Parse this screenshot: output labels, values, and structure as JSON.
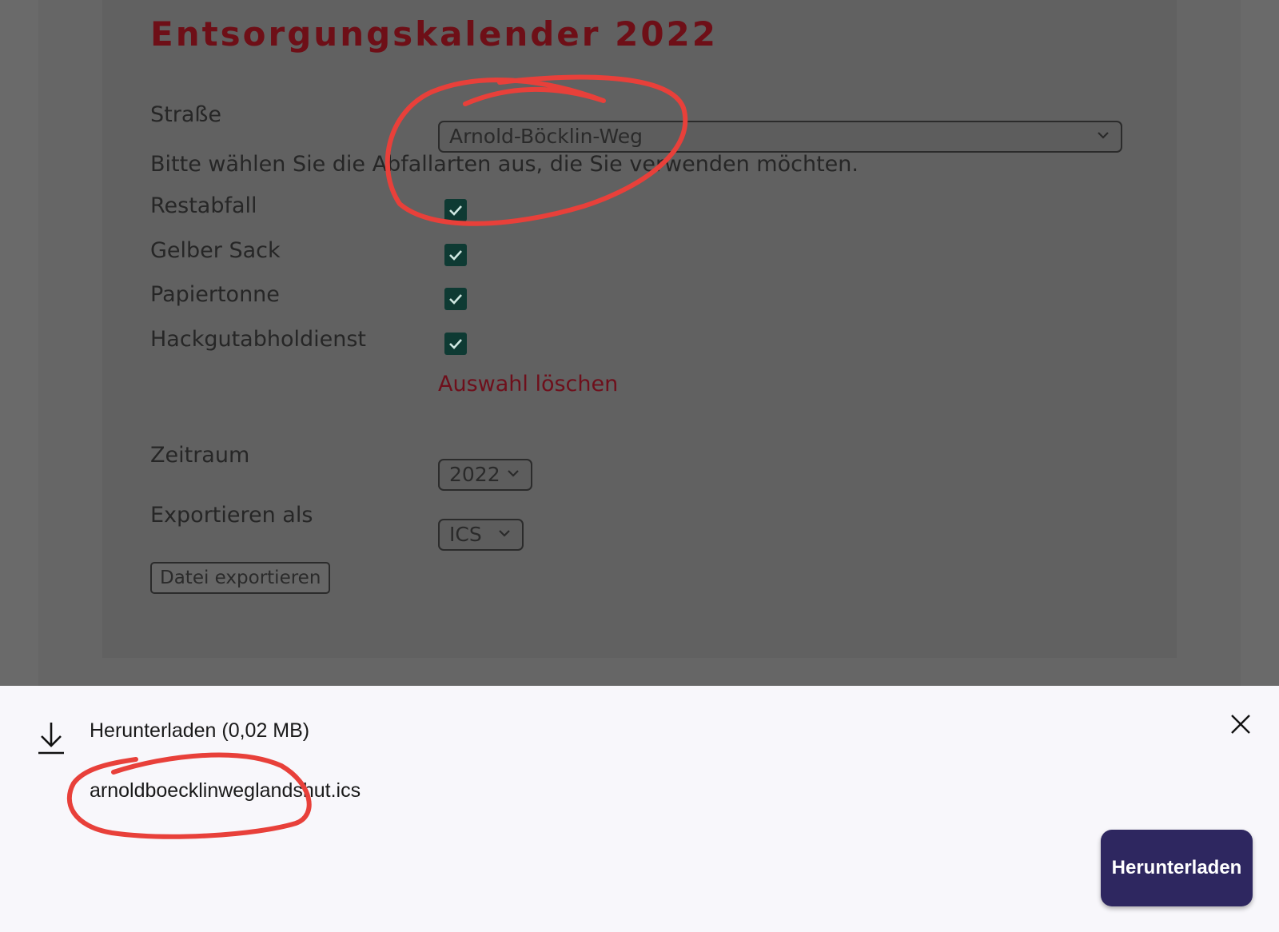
{
  "page": {
    "title": "Entsorgungskalender 2022"
  },
  "form": {
    "street_label": "Straße",
    "street_value": "Arnold-Böcklin-Weg",
    "instruction": "Bitte wählen Sie die Abfallarten aus, die Sie verwenden möchten.",
    "waste_types": [
      {
        "label": "Restabfall",
        "checked": true
      },
      {
        "label": "Gelber Sack",
        "checked": true
      },
      {
        "label": "Papiertonne",
        "checked": true
      },
      {
        "label": "Hackgutabholdienst",
        "checked": true
      }
    ],
    "clear_link": "Auswahl löschen",
    "period_label": "Zeitraum",
    "period_value": "2022",
    "export_label": "Exportieren als",
    "export_value": "ICS",
    "export_button": "Datei exportieren"
  },
  "download_sheet": {
    "title": "Herunterladen (0,02 MB)",
    "filename": "arnoldboecklinweglandshut.ics",
    "button": "Herunterladen"
  },
  "colors": {
    "title": "#6e0f17",
    "checkbox": "#0e3a33",
    "link": "#6e0f1b",
    "download_button": "#2e2760",
    "annotation": "#e8403a"
  },
  "icons": {
    "download": "download-icon",
    "close": "close-icon",
    "checkmark": "check-icon",
    "dropdown": "chevron-down-icon"
  }
}
